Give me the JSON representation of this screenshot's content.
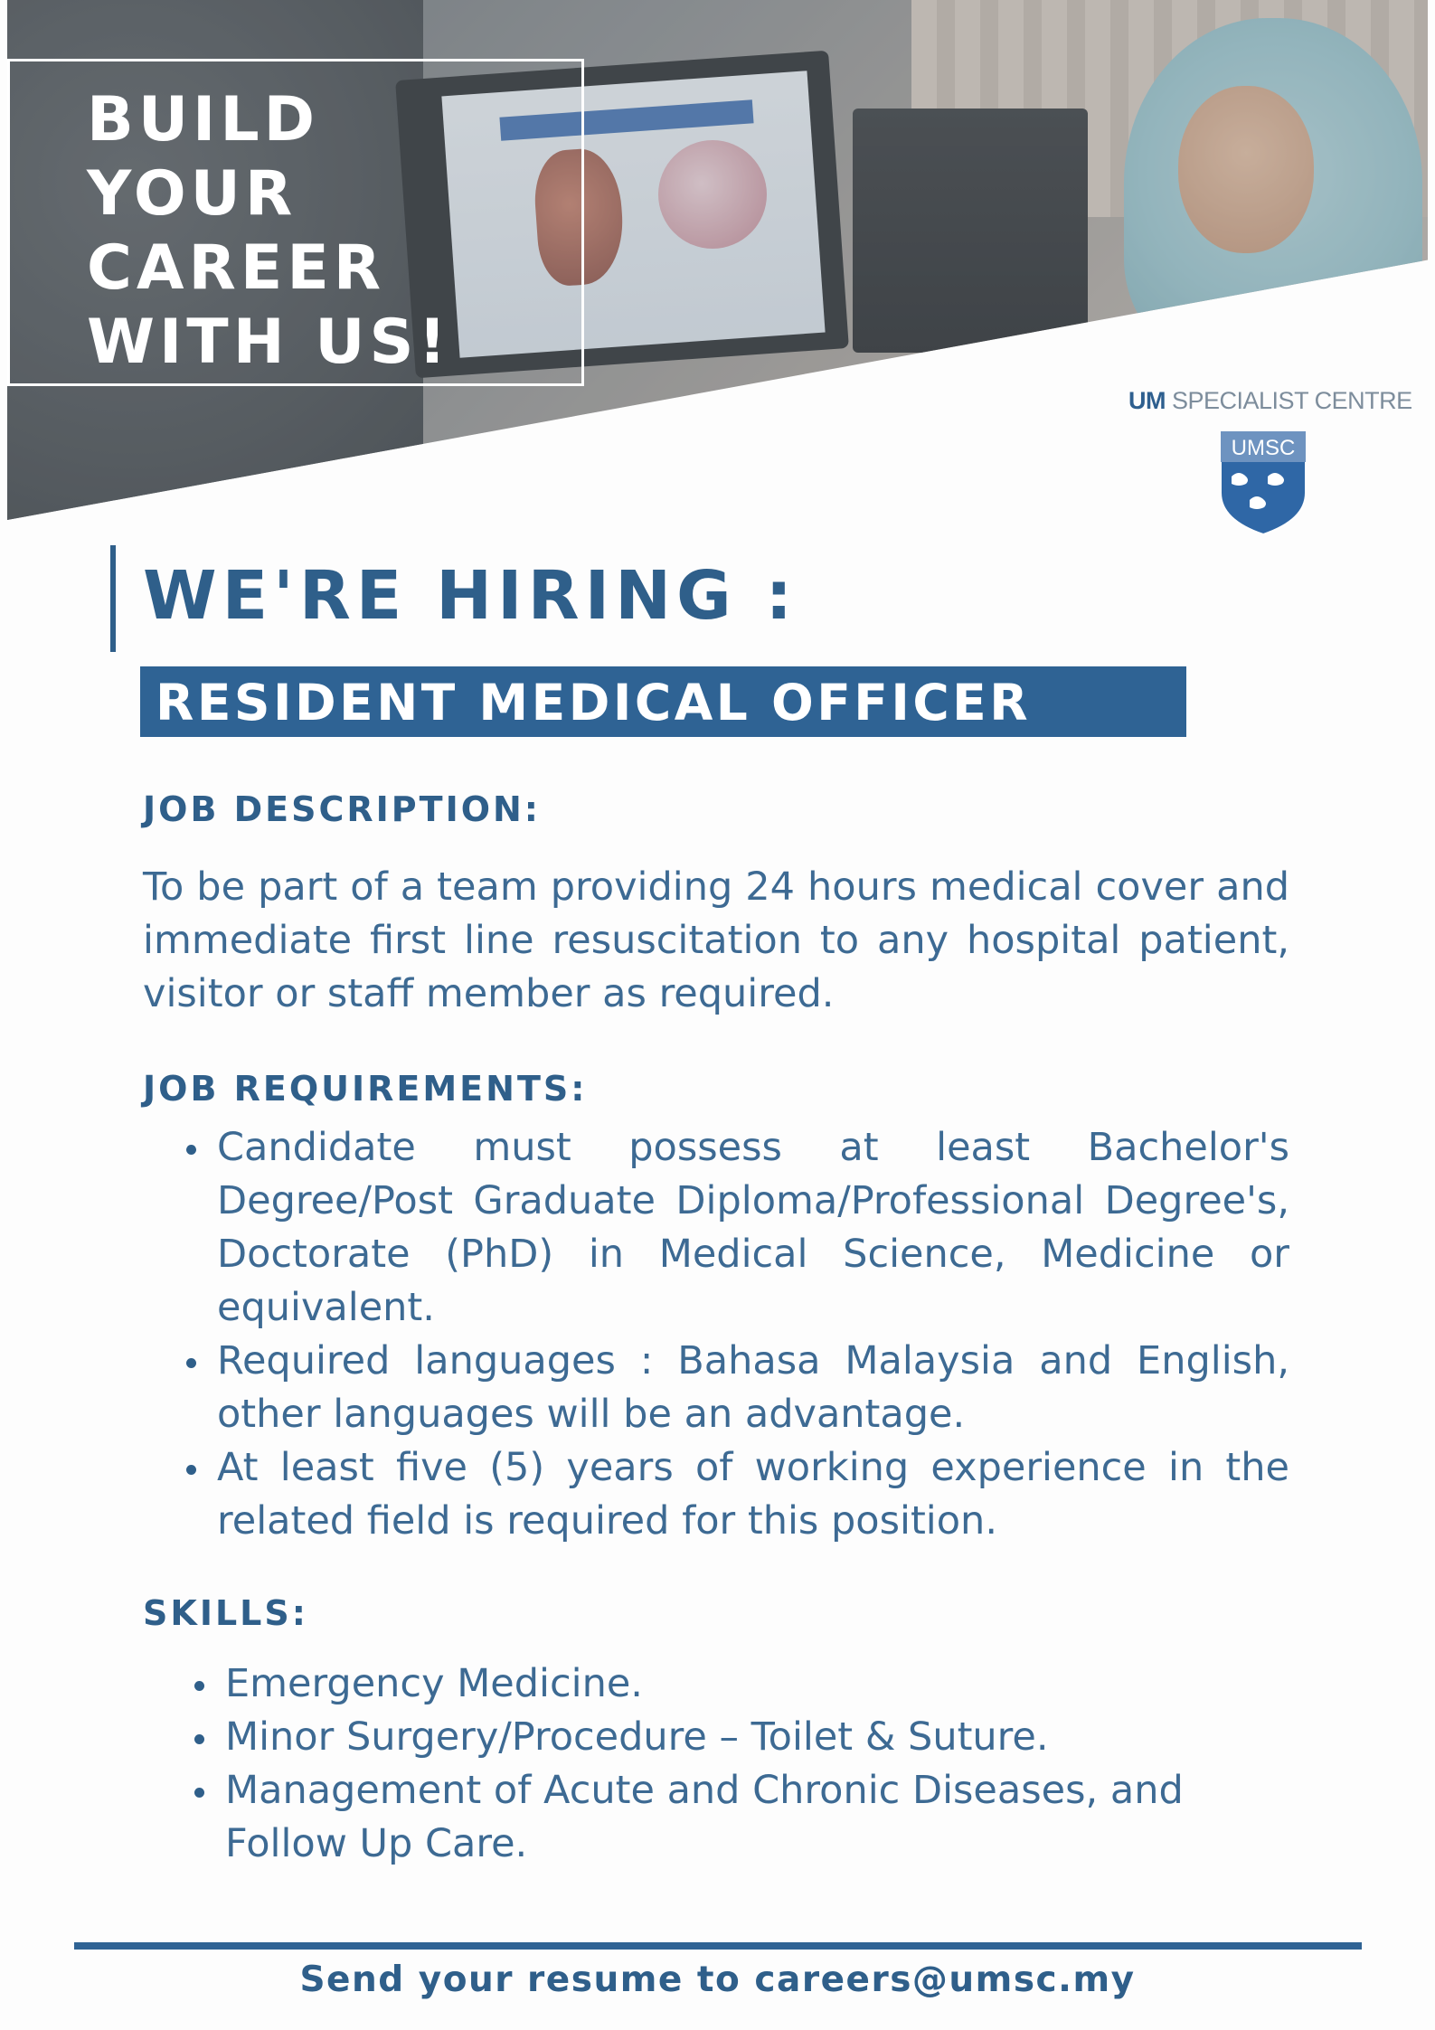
{
  "header": {
    "headline": "BUILD\nYOUR\nCAREER\nWITH US!"
  },
  "logo": {
    "brand_bold": "UM",
    "brand_rest": " SPECIALIST CENTRE",
    "shield_text": "UMSC"
  },
  "hiring": {
    "title": "WE'RE HIRING :",
    "position": "RESIDENT MEDICAL OFFICER"
  },
  "job_description": {
    "heading": "JOB DESCRIPTION:",
    "text": "To be part of a team providing 24 hours medical cover and immediate first line resuscitation to any hospital patient, visitor or staff member as required."
  },
  "job_requirements": {
    "heading": "JOB REQUIREMENTS:",
    "items": [
      "Candidate must possess at least Bachelor's Degree/Post Graduate Diploma/Professional Degree's, Doctorate (PhD) in Medical Science, Medicine or equivalent.",
      "Required languages : Bahasa Malaysia and English, other languages will be an advantage.",
      "At least five (5) years of working experience in the related field is required for this position."
    ]
  },
  "skills": {
    "heading": "SKILLS:",
    "items": [
      "Emergency Medicine.",
      "Minor Surgery/Procedure – Toilet & Suture.",
      "Management of Acute and Chronic Diseases, and Follow Up Care."
    ]
  },
  "footer": {
    "text": "Send your resume to careers@umsc.my"
  },
  "colors": {
    "primary": "#2f5f8a",
    "band": "#2f6394",
    "body_text": "#3d6a93"
  }
}
